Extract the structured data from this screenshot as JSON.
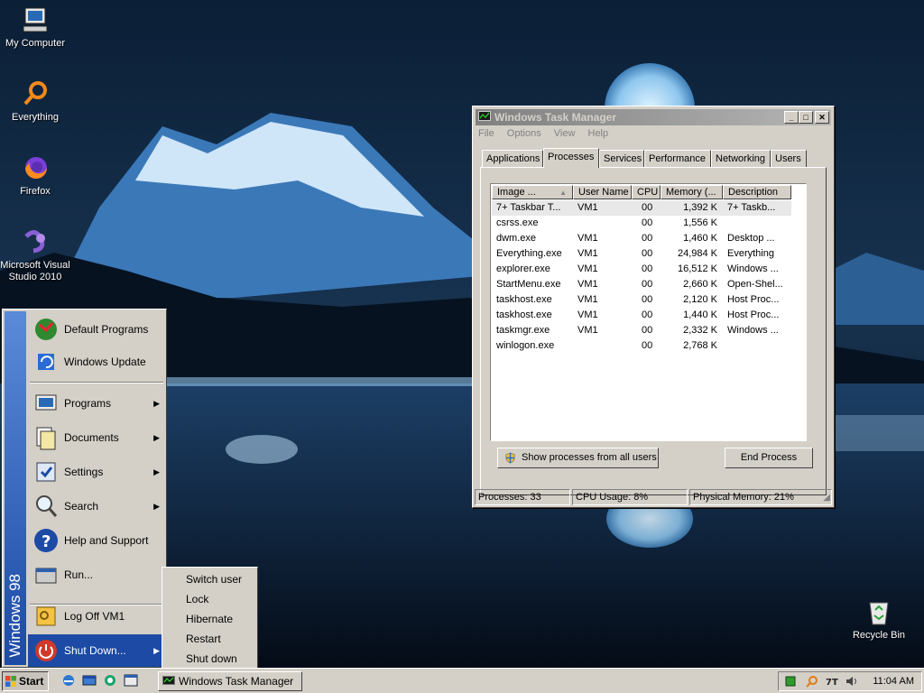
{
  "desktop": {
    "icons": [
      {
        "label": "My Computer",
        "icon": "my-computer-icon"
      },
      {
        "label": "Everything",
        "icon": "everything-search-icon"
      },
      {
        "label": "Firefox",
        "icon": "firefox-icon"
      },
      {
        "label": "Microsoft Visual Studio 2010",
        "line1": "Microsoft Visual",
        "line2": "Studio 2010",
        "icon": "visual-studio-icon"
      },
      {
        "label": "Recycle Bin",
        "icon": "recycle-bin-icon"
      }
    ]
  },
  "task_manager": {
    "title": "Windows Task Manager",
    "controls": {
      "minimize": "_",
      "maximize": "□",
      "close": "✕"
    },
    "menu": [
      "File",
      "Options",
      "View",
      "Help"
    ],
    "tabs": [
      "Applications",
      "Processes",
      "Services",
      "Performance",
      "Networking",
      "Users"
    ],
    "active_tab": "Processes",
    "columns": [
      "Image ...",
      "User Name",
      "CPU",
      "Memory (...",
      "Description"
    ],
    "processes": [
      {
        "image": "7+ Taskbar T...",
        "user": "VM1",
        "cpu": "00",
        "memory": "1,392 K",
        "description": "7+ Taskb..."
      },
      {
        "image": "csrss.exe",
        "user": "",
        "cpu": "00",
        "memory": "1,556 K",
        "description": ""
      },
      {
        "image": "dwm.exe",
        "user": "VM1",
        "cpu": "00",
        "memory": "1,460 K",
        "description": "Desktop ..."
      },
      {
        "image": "Everything.exe",
        "user": "VM1",
        "cpu": "00",
        "memory": "24,984 K",
        "description": "Everything"
      },
      {
        "image": "explorer.exe",
        "user": "VM1",
        "cpu": "00",
        "memory": "16,512 K",
        "description": "Windows ..."
      },
      {
        "image": "StartMenu.exe",
        "user": "VM1",
        "cpu": "00",
        "memory": "2,660 K",
        "description": "Open-Shel..."
      },
      {
        "image": "taskhost.exe",
        "user": "VM1",
        "cpu": "00",
        "memory": "2,120 K",
        "description": "Host Proc..."
      },
      {
        "image": "taskhost.exe",
        "user": "VM1",
        "cpu": "00",
        "memory": "1,440 K",
        "description": "Host Proc..."
      },
      {
        "image": "taskmgr.exe",
        "user": "VM1",
        "cpu": "00",
        "memory": "2,332 K",
        "description": "Windows ..."
      },
      {
        "image": "winlogon.exe",
        "user": "",
        "cpu": "00",
        "memory": "2,768 K",
        "description": ""
      }
    ],
    "show_all_label": "Show processes from all users",
    "end_process_label": "End Process",
    "status": {
      "processes": "Processes: 33",
      "cpu": "CPU Usage: 8%",
      "memory": "Physical Memory: 21%"
    }
  },
  "start_menu": {
    "banner": "Windows 98",
    "items": [
      {
        "label": "Default Programs",
        "icon": "default-programs-icon",
        "submenu": false
      },
      {
        "label": "Windows Update",
        "icon": "windows-update-icon",
        "submenu": false
      },
      {
        "label": "Programs",
        "icon": "programs-icon",
        "submenu": true
      },
      {
        "label": "Documents",
        "icon": "documents-icon",
        "submenu": true
      },
      {
        "label": "Settings",
        "icon": "settings-icon",
        "submenu": true
      },
      {
        "label": "Search",
        "icon": "search-icon",
        "submenu": true
      },
      {
        "label": "Help and Support",
        "icon": "help-icon",
        "submenu": false
      },
      {
        "label": "Run...",
        "icon": "run-icon",
        "submenu": false
      },
      {
        "label": "Log Off VM1",
        "icon": "log-off-icon",
        "submenu": false
      },
      {
        "label": "Shut Down...",
        "icon": "shut-down-icon",
        "submenu": true
      }
    ],
    "arrow": "▶",
    "shutdown_submenu": [
      "Switch user",
      "Lock",
      "Hibernate",
      "Restart",
      "Shut down"
    ]
  },
  "taskbar": {
    "start_label": "Start",
    "task_button": "Windows Task Manager",
    "clock": "11:04 AM",
    "tray_icons": [
      "green-square-icon",
      "search-tray-icon",
      "taskbar-tweaker-icon",
      "volume-icon"
    ]
  },
  "colors": {
    "selection": "#1c4aa5",
    "window_face": "#d4d0c8",
    "title_inactive": "#808080"
  }
}
